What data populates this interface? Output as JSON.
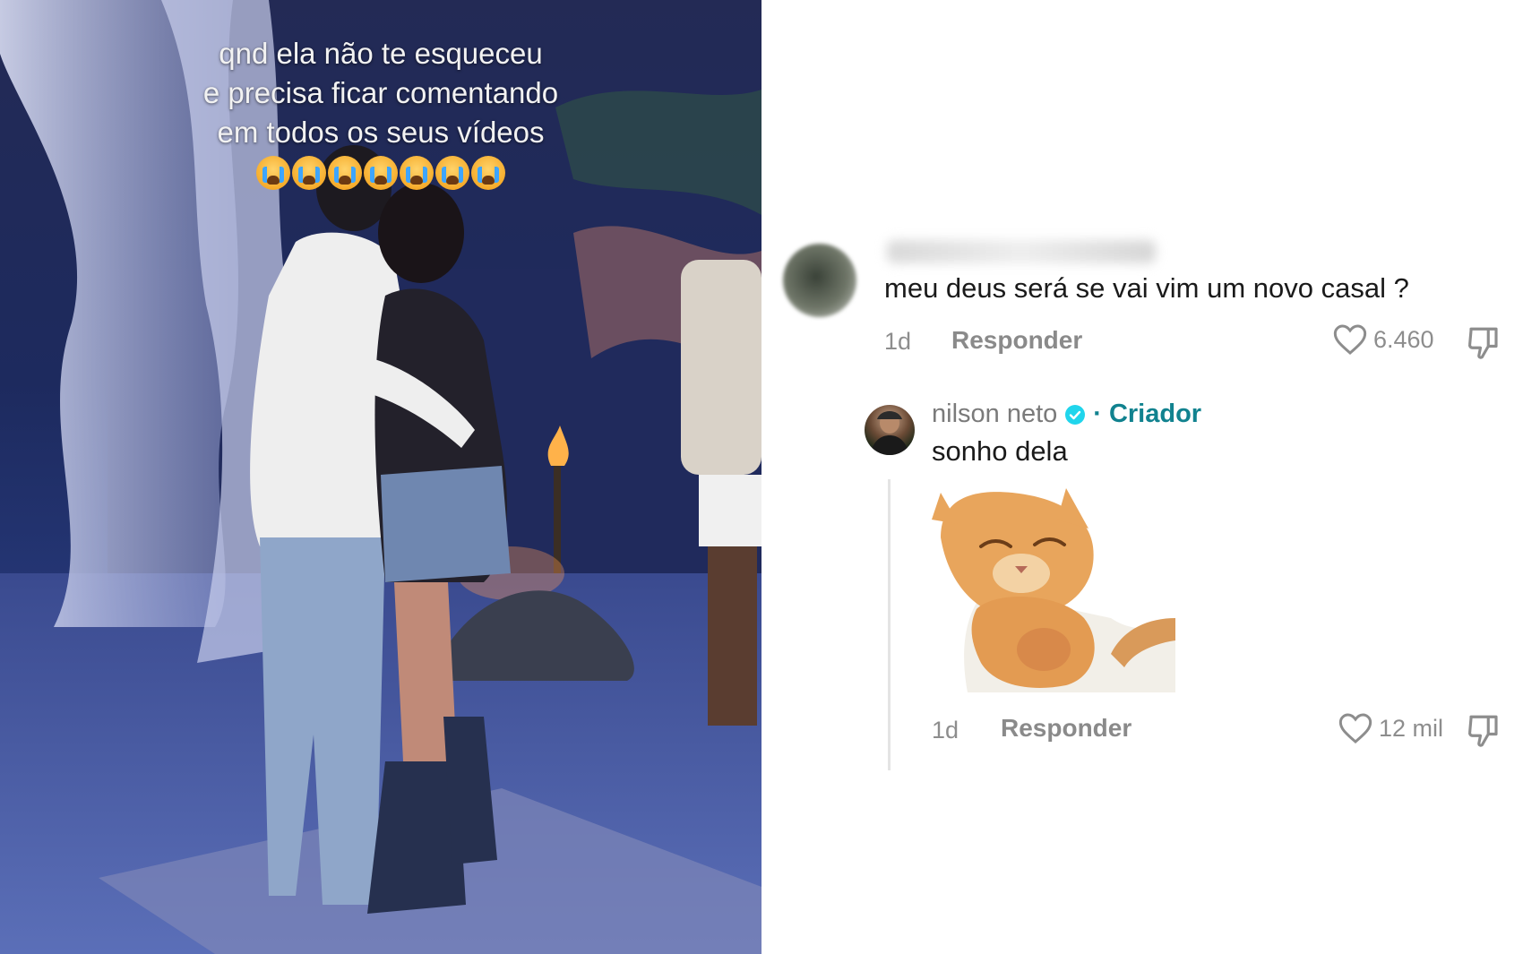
{
  "video": {
    "caption_lines": [
      "qnd ela não te esqueceu",
      "e precisa ficar comentando",
      "em todos os seus vídeos"
    ],
    "emoji_count": 7,
    "emoji_name": "loudly-crying-face"
  },
  "comments": [
    {
      "author": "",
      "text": "meu deus será se vai vim um novo casal ?",
      "age": "1d",
      "reply_label": "Responder",
      "likes": "6.460"
    }
  ],
  "reply": {
    "author": "nilson neto",
    "verified": true,
    "role_separator": "·",
    "role": "Criador",
    "text": "sonho dela",
    "age": "1d",
    "reply_label": "Responder",
    "likes": "12 mil",
    "sticker": "cat-sticker"
  },
  "colors": {
    "creator": "#11828f",
    "verified": "#20d5ec",
    "meta": "#8d8d8d"
  }
}
